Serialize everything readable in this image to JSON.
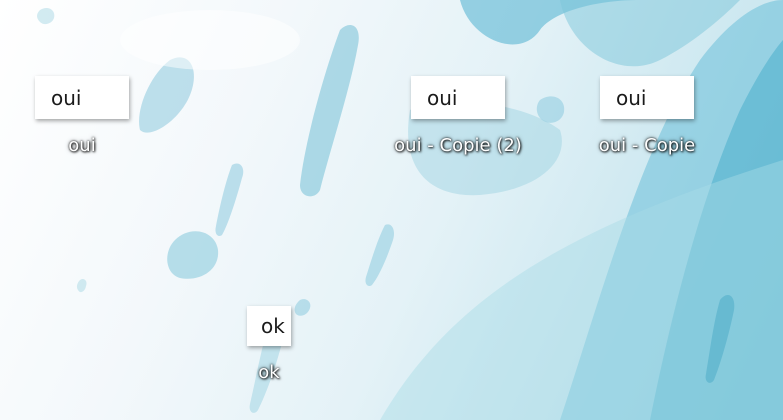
{
  "desktop": {
    "icons": [
      {
        "thumb_text": "oui",
        "label": "oui"
      },
      {
        "thumb_text": "oui",
        "label": "oui - Copie (2)"
      },
      {
        "thumb_text": "oui",
        "label": "oui - Copie"
      },
      {
        "thumb_text": "ok",
        "label": "ok"
      }
    ]
  },
  "colors": {
    "wallpaper_accent": "#5ab3cf"
  }
}
